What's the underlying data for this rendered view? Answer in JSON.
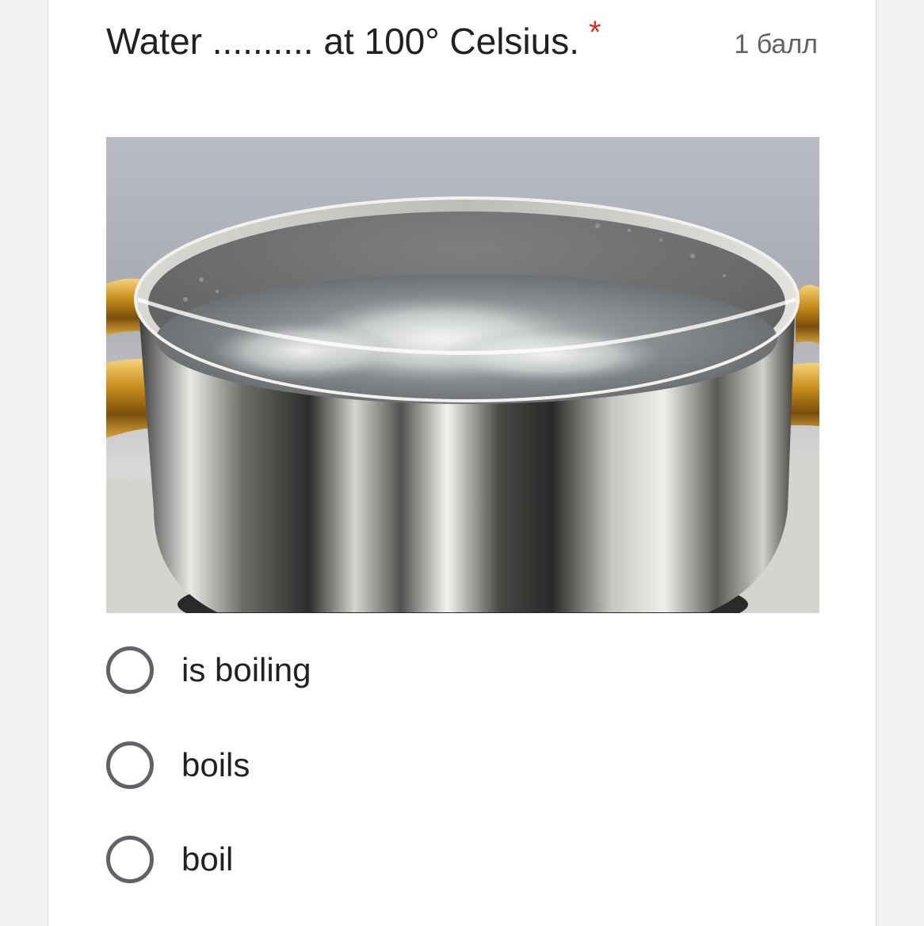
{
  "question": {
    "title": "Water .......... at 100° Celsius.",
    "required_mark": "*",
    "points": "1 балл"
  },
  "image": {
    "subject": "stainless steel pot of boiling water on a stove",
    "icon": "photo-image"
  },
  "options": [
    {
      "label": "is boiling",
      "selected": false
    },
    {
      "label": "boils",
      "selected": false
    },
    {
      "label": "boil",
      "selected": false
    }
  ],
  "colors": {
    "required": "#d93025",
    "text": "#202124",
    "secondary_text": "#5f6368",
    "radio_border": "#5f6368",
    "page_background": "#f1f1ef"
  }
}
